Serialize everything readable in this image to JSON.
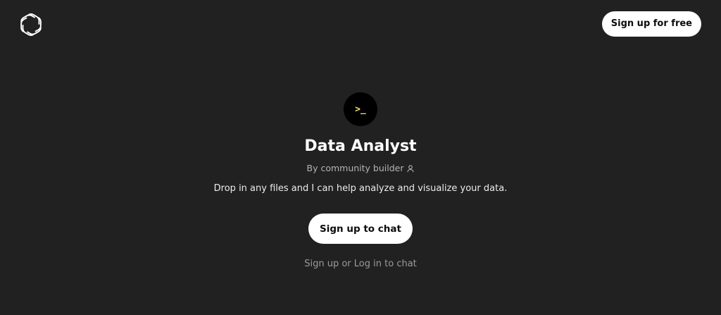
{
  "header": {
    "logo_icon": "openai-logo-icon",
    "signup_free_label": "Sign up for free"
  },
  "gpt": {
    "avatar_text": ">_",
    "avatar_text_color": "#f2e56b",
    "title": "Data Analyst",
    "byline": "By community builder",
    "byline_icon": "person-icon",
    "description": "Drop in any files and I can help analyze and visualize your data."
  },
  "actions": {
    "signup_chat_label": "Sign up to chat",
    "signup_link": "Sign up",
    "or_text": " or ",
    "login_link": "Log in",
    "to_chat_text": " to chat"
  },
  "colors": {
    "background": "#212121",
    "button_bg": "#ffffff",
    "button_text": "#0d0d0d"
  }
}
